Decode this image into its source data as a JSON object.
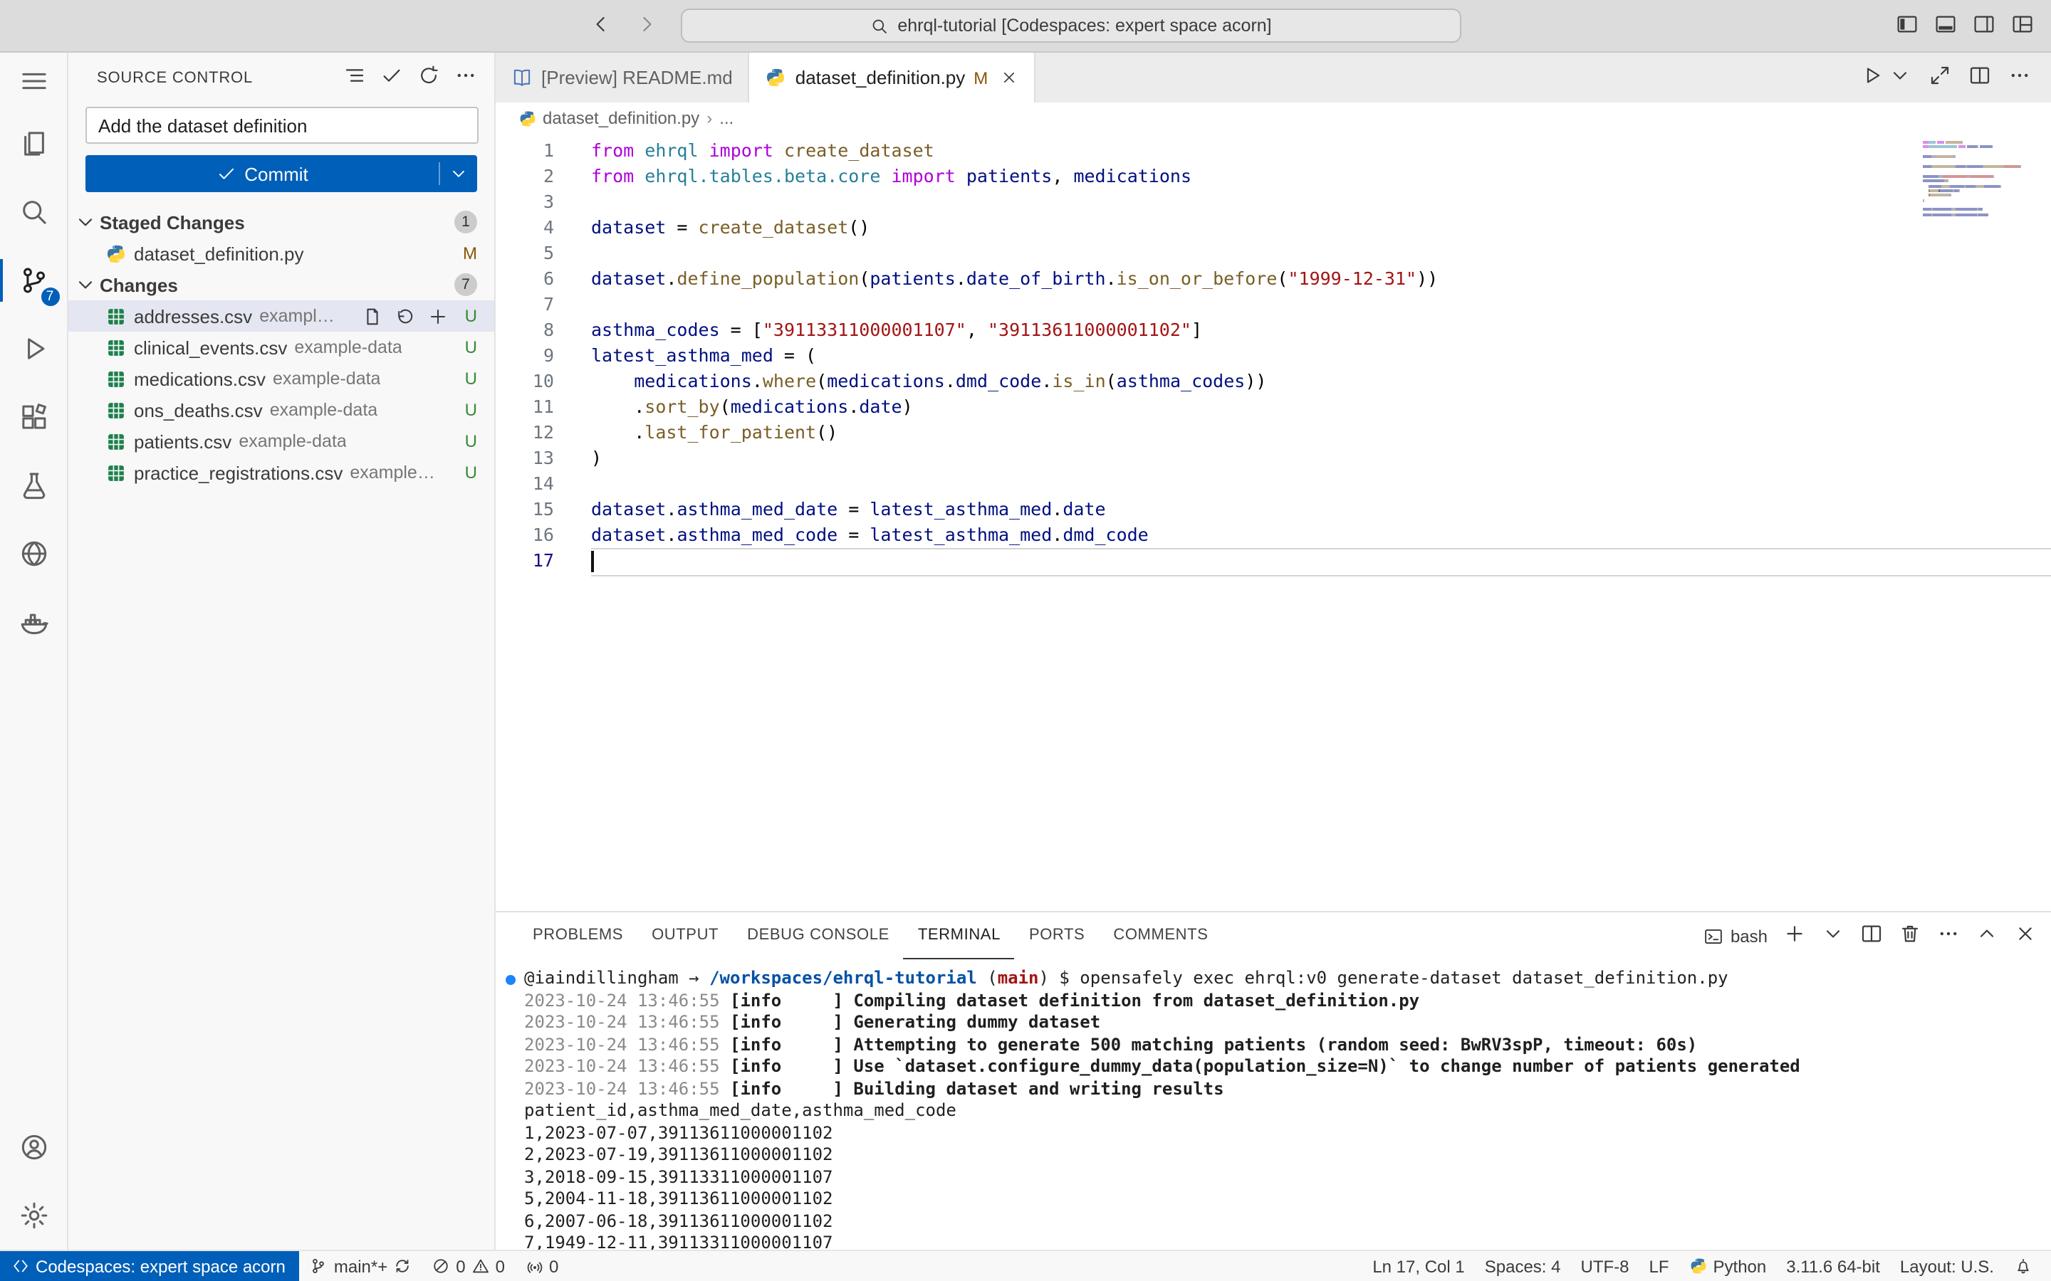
{
  "titlebar": {
    "command_center": "ehrql-tutorial [Codespaces: expert space acorn]",
    "nav": [
      {
        "icon": "arrow-left",
        "name": "back-button"
      },
      {
        "icon": "arrow-right",
        "name": "forward-button"
      }
    ],
    "layout_controls": [
      {
        "icon": "layout-sidebar-left",
        "name": "toggle-primary-sidebar-button"
      },
      {
        "icon": "layout-panel",
        "name": "toggle-panel-button"
      },
      {
        "icon": "layout-sidebar-right",
        "name": "toggle-secondary-sidebar-button"
      },
      {
        "icon": "layout-custom",
        "name": "customize-layout-button"
      }
    ]
  },
  "activity_bar": {
    "top": [
      {
        "icon": "menu",
        "name": "menu"
      },
      {
        "icon": "files",
        "name": "explorer"
      },
      {
        "icon": "search",
        "name": "search"
      },
      {
        "icon": "source-control",
        "name": "source-control",
        "active": true,
        "badge": "7"
      },
      {
        "icon": "debug",
        "name": "run-and-debug"
      },
      {
        "icon": "extensions",
        "name": "extensions"
      },
      {
        "icon": "beaker",
        "name": "testing"
      },
      {
        "icon": "globe",
        "name": "browser-preview"
      },
      {
        "icon": "docker",
        "name": "docker"
      }
    ],
    "bottom": [
      {
        "icon": "account",
        "name": "accounts"
      },
      {
        "icon": "gear",
        "name": "settings"
      }
    ]
  },
  "scm": {
    "title": "SOURCE CONTROL",
    "header_actions": [
      {
        "icon": "list-flat",
        "name": "view-as-list-button"
      },
      {
        "icon": "check",
        "name": "commit-action-button"
      },
      {
        "icon": "refresh",
        "name": "refresh-button"
      },
      {
        "icon": "ellipsis",
        "name": "scm-more-actions-button"
      }
    ],
    "commit_input": "Add the dataset definition",
    "commit_button": "Commit",
    "sections": [
      {
        "label": "Staged Changes",
        "badge": "1",
        "files": [
          {
            "icon": "python-file",
            "name": "dataset_definition.py",
            "desc": "",
            "status": "M"
          }
        ]
      },
      {
        "label": "Changes",
        "badge": "7",
        "files": [
          {
            "icon": "csv-file",
            "name": "addresses.csv",
            "desc": "example-data",
            "status": "U",
            "selected": true,
            "actions": [
              {
                "icon": "go-to-file",
                "name": "open-file-button"
              },
              {
                "icon": "discard",
                "name": "discard-changes-button"
              },
              {
                "icon": "add",
                "name": "stage-changes-button"
              }
            ]
          },
          {
            "icon": "csv-file",
            "name": "clinical_events.csv",
            "desc": "example-data",
            "status": "U"
          },
          {
            "icon": "csv-file",
            "name": "medications.csv",
            "desc": "example-data",
            "status": "U"
          },
          {
            "icon": "csv-file",
            "name": "ons_deaths.csv",
            "desc": "example-data",
            "status": "U"
          },
          {
            "icon": "csv-file",
            "name": "patients.csv",
            "desc": "example-data",
            "status": "U"
          },
          {
            "icon": "csv-file",
            "name": "practice_registrations.csv",
            "desc": "example-...",
            "status": "U"
          }
        ]
      }
    ]
  },
  "editor": {
    "tabs": [
      {
        "icon": "md-preview",
        "label": "[Preview] README.md",
        "active": false
      },
      {
        "icon": "python-file",
        "label": "dataset_definition.py",
        "badge": "M",
        "active": true,
        "close": true
      }
    ],
    "toolbar": [
      {
        "icon": "play",
        "name": "run-python-file-button"
      },
      {
        "icon": "chevron-down",
        "name": "run-dropdown-button"
      },
      {
        "icon": "open-changes",
        "name": "open-changes-button"
      },
      {
        "icon": "split",
        "name": "split-editor-button"
      },
      {
        "icon": "ellipsis",
        "name": "editor-more-actions-button"
      }
    ],
    "breadcrumb": [
      {
        "icon": "python-file",
        "label": "dataset_definition.py"
      },
      {
        "label": "..."
      }
    ],
    "code_lines": [
      {
        "n": "1",
        "t": [
          [
            "from",
            "k"
          ],
          [
            " ",
            "d"
          ],
          [
            "ehrql",
            "c"
          ],
          [
            " ",
            "d"
          ],
          [
            "import",
            "k"
          ],
          [
            " ",
            "d"
          ],
          [
            "create_dataset",
            "f"
          ]
        ]
      },
      {
        "n": "2",
        "t": [
          [
            "from",
            "k"
          ],
          [
            " ",
            "d"
          ],
          [
            "ehrql.tables.beta.core",
            "c"
          ],
          [
            " ",
            "d"
          ],
          [
            "import",
            "k"
          ],
          [
            " ",
            "d"
          ],
          [
            "patients",
            "v"
          ],
          [
            ",",
            "d"
          ],
          [
            " ",
            "d"
          ],
          [
            "medications",
            "v"
          ]
        ]
      },
      {
        "n": "3",
        "t": []
      },
      {
        "n": "4",
        "t": [
          [
            "dataset",
            "v"
          ],
          [
            " = ",
            "d"
          ],
          [
            "create_dataset",
            "f"
          ],
          [
            "()",
            "d"
          ]
        ]
      },
      {
        "n": "5",
        "t": []
      },
      {
        "n": "6",
        "t": [
          [
            "dataset",
            "v"
          ],
          [
            ".",
            "d"
          ],
          [
            "define_population",
            "f"
          ],
          [
            "(",
            "d"
          ],
          [
            "patients",
            "v"
          ],
          [
            ".",
            "d"
          ],
          [
            "date_of_birth",
            "v"
          ],
          [
            ".",
            "d"
          ],
          [
            "is_on_or_before",
            "f"
          ],
          [
            "(",
            "d"
          ],
          [
            "\"1999-12-31\"",
            "s"
          ],
          [
            "))",
            "d"
          ]
        ]
      },
      {
        "n": "7",
        "t": []
      },
      {
        "n": "8",
        "t": [
          [
            "asthma_codes",
            "v"
          ],
          [
            " = [",
            "d"
          ],
          [
            "\"39113311000001107\"",
            "s"
          ],
          [
            ", ",
            "d"
          ],
          [
            "\"39113611000001102\"",
            "s"
          ],
          [
            "]",
            "d"
          ]
        ]
      },
      {
        "n": "9",
        "t": [
          [
            "latest_asthma_med",
            "v"
          ],
          [
            " = (",
            "d"
          ]
        ]
      },
      {
        "n": "10",
        "t": [
          [
            "    ",
            "d"
          ],
          [
            "medications",
            "v"
          ],
          [
            ".",
            "d"
          ],
          [
            "where",
            "f"
          ],
          [
            "(",
            "d"
          ],
          [
            "medications",
            "v"
          ],
          [
            ".",
            "d"
          ],
          [
            "dmd_code",
            "v"
          ],
          [
            ".",
            "d"
          ],
          [
            "is_in",
            "f"
          ],
          [
            "(",
            "d"
          ],
          [
            "asthma_codes",
            "v"
          ],
          [
            "))",
            "d"
          ]
        ]
      },
      {
        "n": "11",
        "t": [
          [
            "    ",
            "d"
          ],
          [
            ".",
            "d"
          ],
          [
            "sort_by",
            "f"
          ],
          [
            "(",
            "d"
          ],
          [
            "medications",
            "v"
          ],
          [
            ".",
            "d"
          ],
          [
            "date",
            "v"
          ],
          [
            ")",
            "d"
          ]
        ]
      },
      {
        "n": "12",
        "t": [
          [
            "    ",
            "d"
          ],
          [
            ".",
            "d"
          ],
          [
            "last_for_patient",
            "f"
          ],
          [
            "()",
            "d"
          ]
        ]
      },
      {
        "n": "13",
        "t": [
          [
            ")",
            "d"
          ]
        ]
      },
      {
        "n": "14",
        "t": []
      },
      {
        "n": "15",
        "t": [
          [
            "dataset",
            "v"
          ],
          [
            ".",
            "d"
          ],
          [
            "asthma_med_date",
            "v"
          ],
          [
            " = ",
            "d"
          ],
          [
            "latest_asthma_med",
            "v"
          ],
          [
            ".",
            "d"
          ],
          [
            "date",
            "v"
          ]
        ]
      },
      {
        "n": "16",
        "t": [
          [
            "dataset",
            "v"
          ],
          [
            ".",
            "d"
          ],
          [
            "asthma_med_code",
            "v"
          ],
          [
            " = ",
            "d"
          ],
          [
            "latest_asthma_med",
            "v"
          ],
          [
            ".",
            "d"
          ],
          [
            "dmd_code",
            "v"
          ]
        ]
      },
      {
        "n": "17",
        "t": [],
        "current": true
      }
    ]
  },
  "panel": {
    "tabs": [
      {
        "label": "PROBLEMS"
      },
      {
        "label": "OUTPUT"
      },
      {
        "label": "DEBUG CONSOLE"
      },
      {
        "label": "TERMINAL",
        "active": true
      },
      {
        "label": "PORTS"
      },
      {
        "label": "COMMENTS"
      }
    ],
    "shell": {
      "icon": "terminal",
      "label": "bash"
    },
    "controls": [
      {
        "icon": "add",
        "name": "new-terminal-button"
      },
      {
        "icon": "chevron-down",
        "name": "terminal-dropdown-button"
      },
      {
        "icon": "split",
        "name": "split-terminal-button"
      },
      {
        "icon": "trash",
        "name": "kill-terminal-button"
      },
      {
        "icon": "ellipsis",
        "name": "terminal-more-actions-button"
      },
      {
        "icon": "chevron-up",
        "name": "maximize-panel-button"
      },
      {
        "icon": "close",
        "name": "close-panel-button"
      }
    ],
    "terminal_lines": [
      {
        "deco": true,
        "seg": [
          [
            "@iaindillingham ",
            "p"
          ],
          [
            "→ ",
            "p"
          ],
          [
            "/workspaces/ehrql-tutorial",
            "path"
          ],
          [
            " (",
            "p"
          ],
          [
            "main",
            "branch"
          ],
          [
            ") ",
            "p"
          ],
          [
            "$ opensafely exec ehrql:v0 generate-dataset dataset_definition.py",
            "p"
          ]
        ]
      },
      {
        "seg": [
          [
            "2023-10-24 13:46:55 ",
            "dim"
          ],
          [
            "[info     ] ",
            "b"
          ],
          [
            "Compiling dataset definition from dataset_definition.py",
            "b"
          ]
        ]
      },
      {
        "seg": [
          [
            "2023-10-24 13:46:55 ",
            "dim"
          ],
          [
            "[info     ] ",
            "b"
          ],
          [
            "Generating dummy dataset",
            "b"
          ]
        ]
      },
      {
        "seg": [
          [
            "2023-10-24 13:46:55 ",
            "dim"
          ],
          [
            "[info     ] ",
            "b"
          ],
          [
            "Attempting to generate 500 matching patients (random seed: BwRV3spP, timeout: 60s)",
            "b"
          ]
        ]
      },
      {
        "seg": [
          [
            "2023-10-24 13:46:55 ",
            "dim"
          ],
          [
            "[info     ] ",
            "b"
          ],
          [
            "Use `dataset.configure_dummy_data(population_size=N)` to change number of patients generated",
            "b"
          ]
        ]
      },
      {
        "seg": [
          [
            "2023-10-24 13:46:55 ",
            "dim"
          ],
          [
            "[info     ] ",
            "b"
          ],
          [
            "Building dataset and writing results",
            "b"
          ]
        ]
      },
      {
        "seg": [
          [
            "patient_id,asthma_med_date,asthma_med_code",
            "p"
          ]
        ]
      },
      {
        "seg": [
          [
            "1,2023-07-07,39113611000001102",
            "p"
          ]
        ]
      },
      {
        "seg": [
          [
            "2,2023-07-19,39113611000001102",
            "p"
          ]
        ]
      },
      {
        "seg": [
          [
            "3,2018-09-15,39113311000001107",
            "p"
          ]
        ]
      },
      {
        "seg": [
          [
            "5,2004-11-18,39113611000001102",
            "p"
          ]
        ]
      },
      {
        "seg": [
          [
            "6,2007-06-18,39113611000001102",
            "p"
          ]
        ]
      },
      {
        "seg": [
          [
            "7,1949-12-11,39113311000001107",
            "p"
          ]
        ]
      }
    ]
  },
  "statusbar": {
    "left": [
      {
        "name": "remote-indicator",
        "cls": "remote",
        "parts": [
          {
            "i": "remote"
          },
          {
            "t": "Codespaces: expert space acorn"
          }
        ]
      },
      {
        "name": "git-branch-status",
        "parts": [
          {
            "i": "branch"
          },
          {
            "t": "main*+"
          },
          {
            "i": "sync"
          }
        ]
      },
      {
        "name": "problems-status",
        "parts": [
          {
            "i": "error"
          },
          {
            "t": "0"
          },
          {
            "i": "warning"
          },
          {
            "t": "0"
          }
        ]
      },
      {
        "name": "forwarded-ports",
        "parts": [
          {
            "i": "broadcast"
          },
          {
            "t": "0"
          }
        ]
      }
    ],
    "right": [
      {
        "name": "cursor-position",
        "parts": [
          {
            "t": "Ln 17, Col 1"
          }
        ]
      },
      {
        "name": "indentation",
        "parts": [
          {
            "t": "Spaces: 4"
          }
        ]
      },
      {
        "name": "encoding",
        "parts": [
          {
            "t": "UTF-8"
          }
        ]
      },
      {
        "name": "eol-indicator",
        "parts": [
          {
            "t": "LF"
          }
        ]
      },
      {
        "name": "language-mode",
        "parts": [
          {
            "i": "python-mini"
          },
          {
            "t": "Python"
          }
        ]
      },
      {
        "name": "python-interpreter",
        "parts": [
          {
            "t": "3.11.6 64-bit"
          }
        ]
      },
      {
        "name": "keyboard-layout",
        "parts": [
          {
            "t": "Layout: U.S."
          }
        ]
      },
      {
        "name": "notifications-bell",
        "parts": [
          {
            "i": "bell"
          }
        ]
      }
    ]
  }
}
